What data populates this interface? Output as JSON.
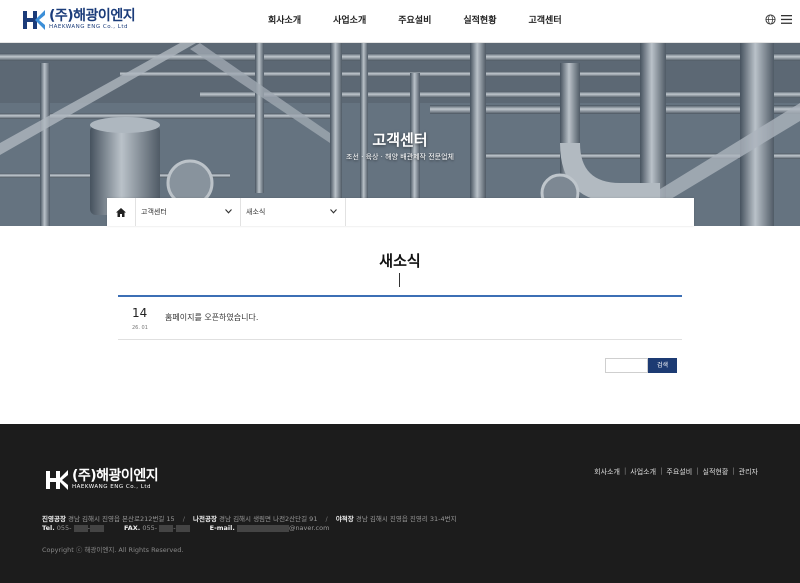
{
  "header": {
    "logo_name": "(주)해광이엔지",
    "logo_sub": "HAEKWANG ENG Co., Ltd",
    "nav": [
      "회사소개",
      "사업소개",
      "주요설비",
      "실적현황",
      "고객센터"
    ],
    "icons": [
      "globe-icon",
      "menu-icon"
    ]
  },
  "banner": {
    "title": "고객센터",
    "subtitle": "조선 · 육상 · 해양 배관제작 전문업체"
  },
  "location": {
    "home_icon": "home-icon",
    "depth1": "고객센터",
    "depth2": "새소식"
  },
  "main": {
    "title": "새소식",
    "posts": [
      {
        "day": "14",
        "year_month": "26. 01",
        "title": "홈페이지를 오픈하였습니다."
      }
    ],
    "search_button": "검색",
    "search_placeholder": ""
  },
  "footer": {
    "logo_name": "(주)해광이엔지",
    "logo_sub": "HAEKWANG ENG Co., Ltd",
    "nav": [
      "회사소개",
      "사업소개",
      "주요설비",
      "실적현황",
      "관리자"
    ],
    "factory1_label": "진영공장",
    "factory1_addr": "경남 김해시 진영읍 본산로212번길 15",
    "factory2_label": "나전공장",
    "factory2_addr": "경남 김해시 생림면 나전2산단길 91",
    "factory3_label": "야적장",
    "factory3_addr": "경남 김해시 진영읍 진영리 31-4번지",
    "tel_label": "Tel.",
    "tel_value": "055-",
    "fax_label": "FAX.",
    "fax_value": "055-",
    "email_label": "E-mail.",
    "email_value": "@naver.com",
    "copyright": "Copyright ⓒ 해광이엔지. All Rights Reserved."
  },
  "colors": {
    "brand": "#1b3c7a",
    "accent_line": "#3c6fb5",
    "search_button": "#1d3b73",
    "footer_bg": "#1c1c1c"
  }
}
